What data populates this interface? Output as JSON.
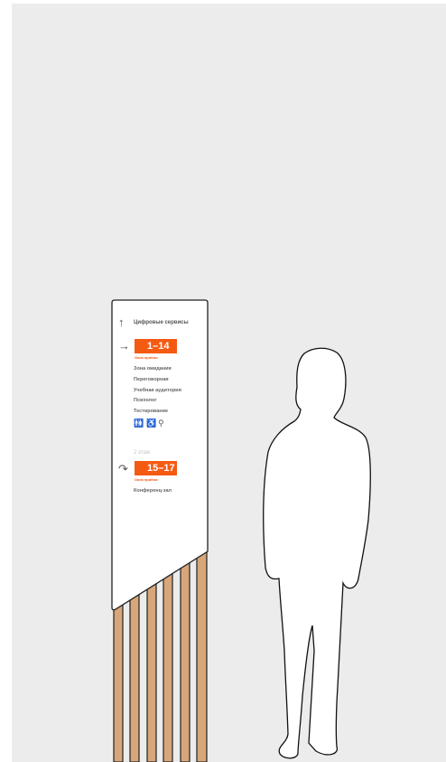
{
  "sign": {
    "top_direction_label": "Цифровые сервисы",
    "top_direction_icon": "arrow-up-icon",
    "badge_1": {
      "range": "1–14",
      "caption": "Окна приёма",
      "direction_icon": "arrow-right-icon"
    },
    "rooms": [
      "Зона ожидания",
      "Переговорная",
      "Учебная аудитория",
      "Психолог",
      "Тестирование"
    ],
    "pictograms": [
      "restroom-icon",
      "wheelchair-icon",
      "baby-changing-icon"
    ],
    "floor_label": "2 этаж",
    "badge_2": {
      "range": "15–17",
      "caption": "Окна приёма",
      "direction_icon": "arrow-up-turn-icon"
    },
    "floor_rooms": [
      "Конференц-зал"
    ]
  },
  "colors": {
    "background": "#ececec",
    "accent": "#f55a13",
    "wood": "#d7a67a",
    "text": "#555555"
  }
}
